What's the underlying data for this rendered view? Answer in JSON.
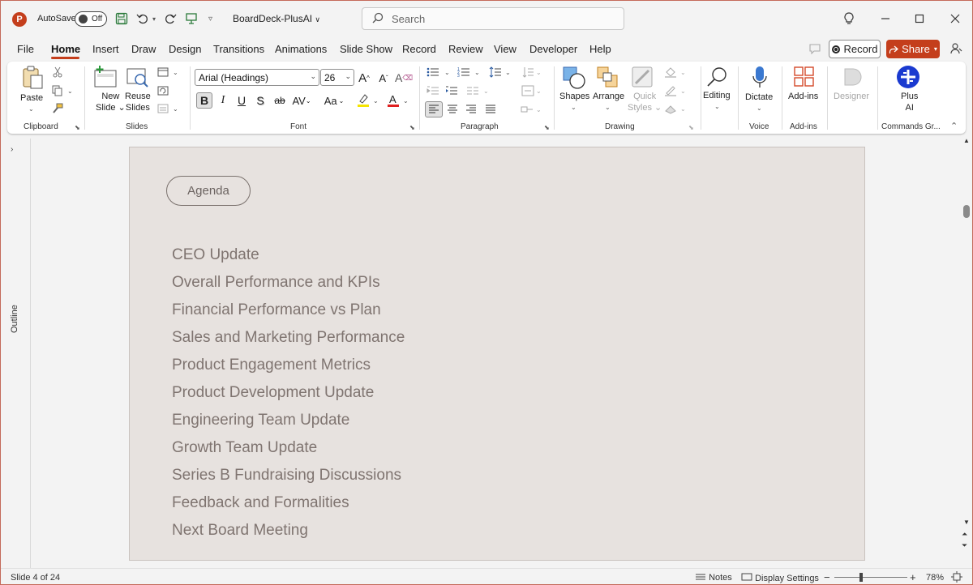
{
  "app": {
    "autosave_label": "AutoSave",
    "autosave_state": "Off",
    "filename": "BoardDeck-PlusAI",
    "search_placeholder": "Search",
    "accent_color": "#c43e1c"
  },
  "menu": {
    "tabs": [
      "File",
      "Home",
      "Insert",
      "Draw",
      "Design",
      "Transitions",
      "Animations",
      "Slide Show",
      "Record",
      "Review",
      "View",
      "Developer",
      "Help"
    ],
    "active_tab": "Home",
    "record_label": "Record",
    "share_label": "Share"
  },
  "ribbon": {
    "clipboard": {
      "paste": "Paste",
      "label": "Clipboard"
    },
    "slides": {
      "new_slide_1": "New",
      "new_slide_2": "Slide",
      "reuse_1": "Reuse",
      "reuse_2": "Slides",
      "label": "Slides"
    },
    "font": {
      "font_name": "Arial (Headings)",
      "font_size": "26",
      "bold": "B",
      "italic": "I",
      "underline": "U",
      "shadow": "S",
      "strike": "ab",
      "spacing": "AV",
      "case": "Aa",
      "label": "Font"
    },
    "paragraph": {
      "label": "Paragraph"
    },
    "drawing": {
      "shapes": "Shapes",
      "arrange": "Arrange",
      "quick_styles_1": "Quick",
      "quick_styles_2": "Styles",
      "label": "Drawing"
    },
    "editing": {
      "label": "Editing"
    },
    "voice": {
      "dictate": "Dictate",
      "label": "Voice"
    },
    "addins": {
      "button": "Add-ins",
      "label": "Add-ins"
    },
    "designer": {
      "label": "Designer"
    },
    "plusai": {
      "line1": "Plus",
      "line2": "AI",
      "label": "Commands Gr..."
    }
  },
  "outline_pane": {
    "label": "Outline"
  },
  "slide": {
    "pill": "Agenda",
    "items": [
      "CEO Update",
      "Overall Performance and KPIs",
      "Financial Performance vs Plan",
      "Sales and Marketing Performance",
      "Product Engagement Metrics",
      "Product Development Update",
      "Engineering Team Update",
      "Growth Team Update",
      "Series B Fundraising Discussions",
      "Feedback and Formalities",
      "Next Board Meeting"
    ]
  },
  "status": {
    "slide_info": "Slide 4 of 24",
    "notes": "Notes",
    "display_settings": "Display Settings",
    "zoom": "78%"
  }
}
